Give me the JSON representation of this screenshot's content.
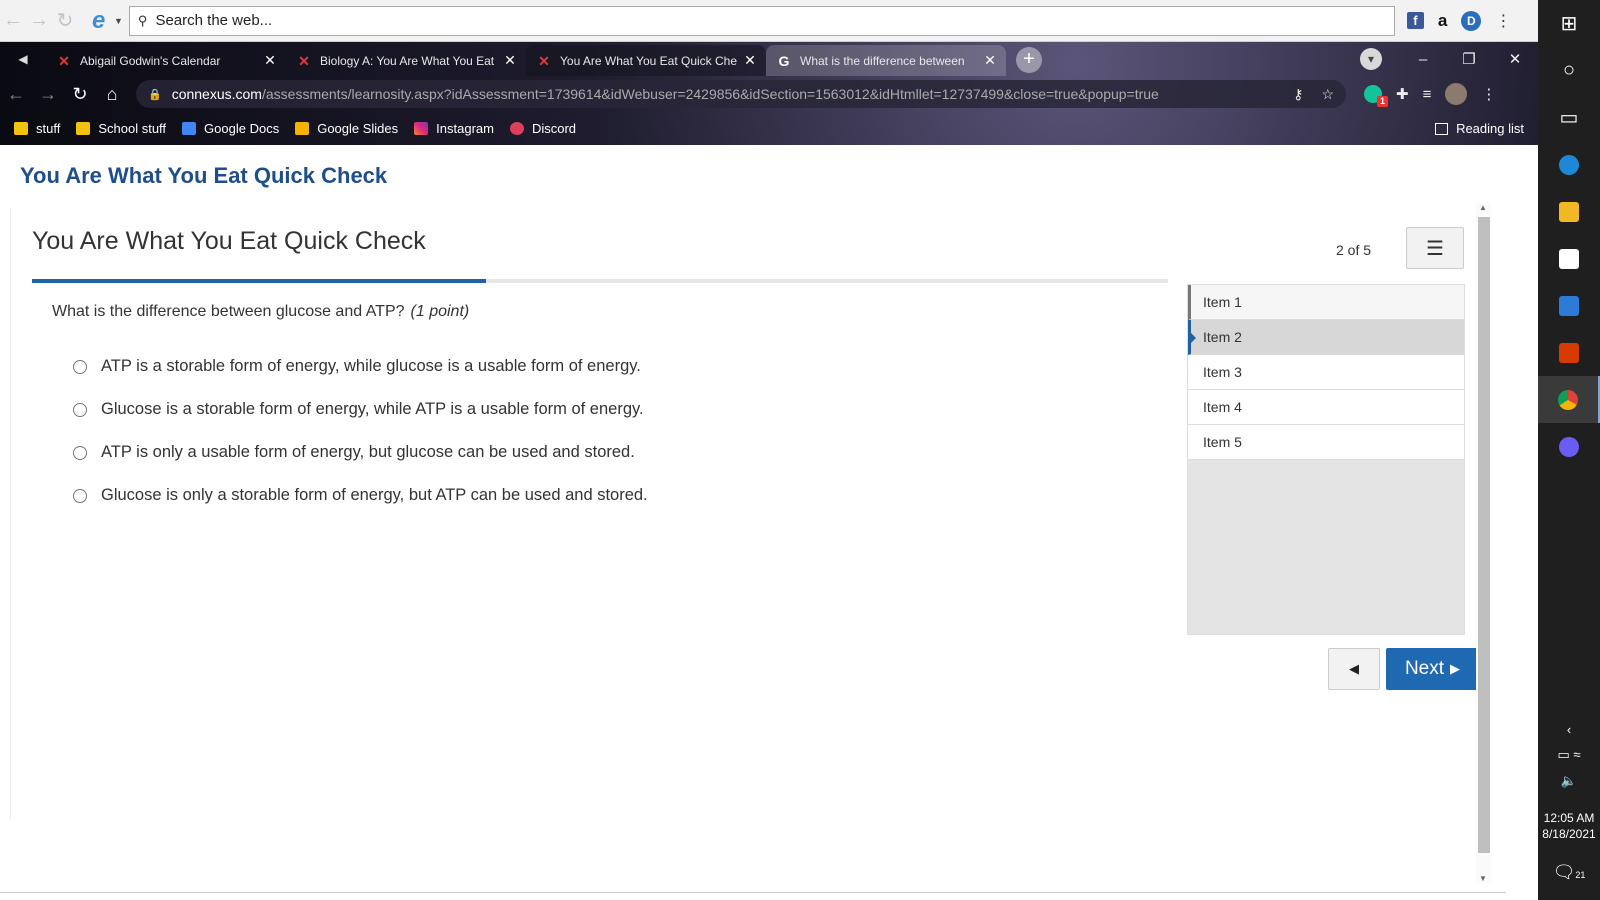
{
  "search_toolbar": {
    "placeholder": "Search the web..."
  },
  "tabs": [
    {
      "title": "Abigail Godwin's Calendar",
      "favicon": "connexus-icon"
    },
    {
      "title": "Biology A: You Are What You Eat",
      "favicon": "connexus-icon"
    },
    {
      "title": "You Are What You Eat Quick Che",
      "favicon": "connexus-icon",
      "active": true
    },
    {
      "title": "What is the difference between",
      "favicon": "google-icon"
    }
  ],
  "address": {
    "domain": "connexus.com",
    "path": "/assessments/learnosity.aspx?idAssessment=1739614&idWebuser=2429856&idSection=1563012&idHtmllet=12737499&close=true&popup=true"
  },
  "bookmarks": [
    {
      "label": "stuff",
      "icon": "folder"
    },
    {
      "label": "School stuff",
      "icon": "folder"
    },
    {
      "label": "Google Docs",
      "icon": "docs"
    },
    {
      "label": "Google Slides",
      "icon": "slides"
    },
    {
      "label": "Instagram",
      "icon": "insta"
    },
    {
      "label": "Discord",
      "icon": "discord"
    }
  ],
  "reading_list": "Reading list",
  "page": {
    "header_title": "You Are What You Eat Quick Check",
    "quiz_title": "You Are What You Eat Quick Check",
    "progress": 0.4,
    "counter": "2 of 5",
    "question": "What is the difference between glucose and ATP?",
    "points": "(1 point)",
    "options": [
      " ATP is a storable form of energy, while glucose is a usable form of energy.",
      "Glucose is a storable form of energy, while ATP is a usable form of energy.",
      "ATP is only a usable form of energy, but glucose can be used and stored.",
      "Glucose is only a storable form of energy, but ATP can be used and stored."
    ],
    "items": [
      {
        "label": "Item 1",
        "state": "visited"
      },
      {
        "label": "Item 2",
        "state": "current"
      },
      {
        "label": "Item 3",
        "state": "unvisited"
      },
      {
        "label": "Item 4",
        "state": "unvisited"
      },
      {
        "label": "Item 5",
        "state": "unvisited"
      }
    ],
    "next_label": "Next"
  },
  "taskbar": {
    "time": "12:05 AM",
    "date": "8/18/2021",
    "notifications": "21"
  },
  "colors": {
    "accent": "#1f69b2",
    "title_blue": "#1f4e8c"
  }
}
